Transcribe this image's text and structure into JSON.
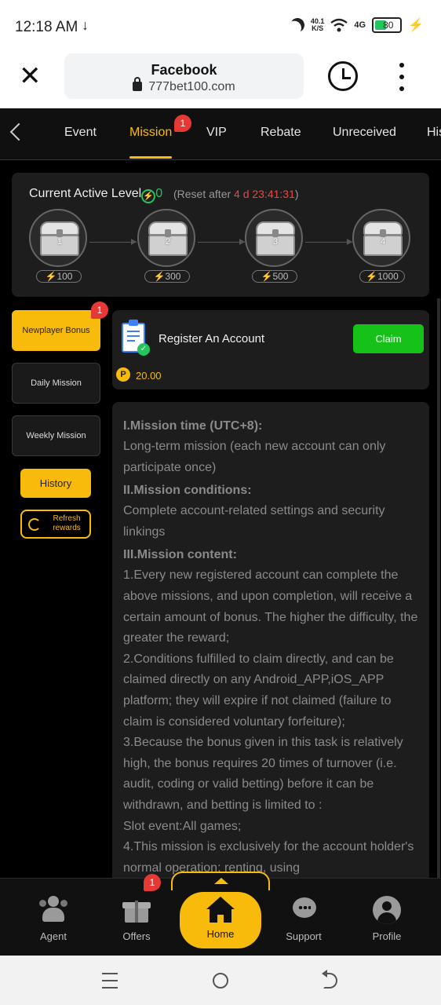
{
  "status_bar": {
    "time": "12:18 AM",
    "download_glyph": "↓",
    "net_speed": "40.1",
    "net_unit": "K/S",
    "network": "4G",
    "battery": "80"
  },
  "browser": {
    "title": "Facebook",
    "url": "777bet100.com",
    "close_glyph": "✕"
  },
  "tabs": {
    "items": [
      "Event",
      "Mission",
      "VIP",
      "Rebate",
      "Unreceived",
      "His"
    ],
    "active": "Mission",
    "mission_badge": "1"
  },
  "level": {
    "title": "Current Active Level",
    "value": "0",
    "reset_prefix": "(Reset after ",
    "reset_time": "4 d 23:41:31",
    "reset_suffix": ")",
    "chests": [
      {
        "num": "1",
        "points": "100"
      },
      {
        "num": "2",
        "points": "300"
      },
      {
        "num": "3",
        "points": "500"
      },
      {
        "num": "4",
        "points": "1000"
      }
    ]
  },
  "sidebar": {
    "newplayer": "Newplayer Bonus",
    "newplayer_badge": "1",
    "daily": "Daily Mission",
    "weekly": "Weekly Mission",
    "history": "History",
    "refresh": "Refresh rewards"
  },
  "task": {
    "title": "Register An Account",
    "claim": "Claim",
    "coin_symbol": "P",
    "reward": "20.00"
  },
  "rules": {
    "h1": "I.Mission time (UTC+8):",
    "p1": "Long-term mission (each new account can only participate once)",
    "h2": "II.Mission conditions:",
    "p2": "Complete account-related settings and security linkings",
    "h3": "III.Mission content:",
    "p3": "1.Every new registered account can complete the above missions, and upon completion, will receive a certain amount of bonus. The higher the difficulty, the greater the reward;",
    "p4": "2.Conditions fulfilled to claim directly, and can be claimed directly on any Android_APP,iOS_APP platform; they will expire if not claimed (failure to claim is considered voluntary forfeiture);",
    "p5": "3.Because the bonus given in this task is relatively high, the bonus requires 20 times of turnover (i.e. audit, coding or valid betting) before it can be withdrawn, and betting is limited to :",
    "p6": "Slot event:All games;",
    "p7": "4.This mission is exclusively for the account holder's normal operation; renting, using"
  },
  "bottom_nav": {
    "agent": "Agent",
    "offers": "Offers",
    "offers_badge": "1",
    "home": "Home",
    "support": "Support",
    "profile": "Profile"
  }
}
